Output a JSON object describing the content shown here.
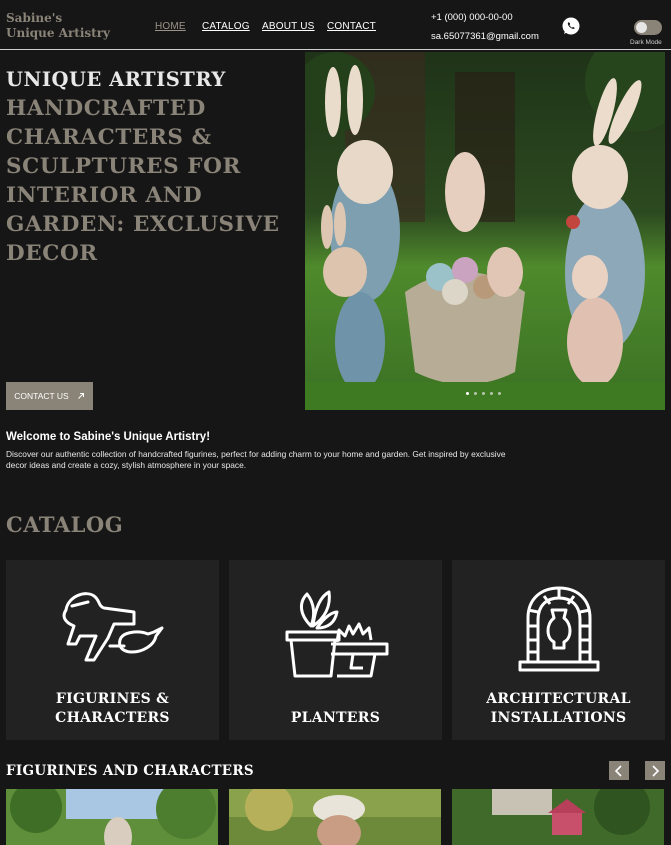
{
  "header": {
    "logo_line1": "Sabine's",
    "logo_line2": "Unique Artistry",
    "nav": [
      {
        "label": "HOME",
        "active": true
      },
      {
        "label": "CATALOG",
        "active": false
      },
      {
        "label": "ABOUT US",
        "active": false
      },
      {
        "label": "CONTACT",
        "active": false
      }
    ],
    "phone": "+1 (000) 000-00-00",
    "email": "sa.65077361@gmail.com",
    "whatsapp_icon": "whatsapp-icon",
    "dark_mode_label": "Dark Mode",
    "dark_mode_on": false
  },
  "hero": {
    "title_line": "UNIQUE ARTISTRY",
    "subtitle": "HANDCRAFTED CHARACTERS & SCULPTURES FOR INTERIOR AND GARDEN: EXCLUSIVE DECOR",
    "contact_button": "CONTACT US",
    "contact_button_icon": "arrow-up-right-icon",
    "slide_count": 5,
    "active_slide": 1
  },
  "welcome": {
    "title": "Welcome to Sabine's Unique Artistry!",
    "text": "Discover our authentic collection of handcrafted figurines, perfect for adding charm to your home and garden. Get inspired by exclusive decor ideas and create a cozy, stylish atmosphere in your space."
  },
  "catalog": {
    "title": "CATALOG",
    "cards": [
      {
        "line1": "FIGURINES &",
        "line2": "CHARACTERS",
        "icon": "horse-bird-icon"
      },
      {
        "line1": "",
        "line2": "PLANTERS",
        "icon": "planter-icon"
      },
      {
        "line1": "ARCHITECTURAL",
        "line2": "INSTALLATIONS",
        "icon": "arch-vase-icon"
      }
    ]
  },
  "figurines": {
    "title": "FIGURINES AND CHARACTERS",
    "prev_icon": "chevron-left-icon",
    "next_icon": "chevron-right-icon"
  },
  "colors": {
    "accent": "#8a8378",
    "background": "#161616",
    "card": "#222222"
  }
}
